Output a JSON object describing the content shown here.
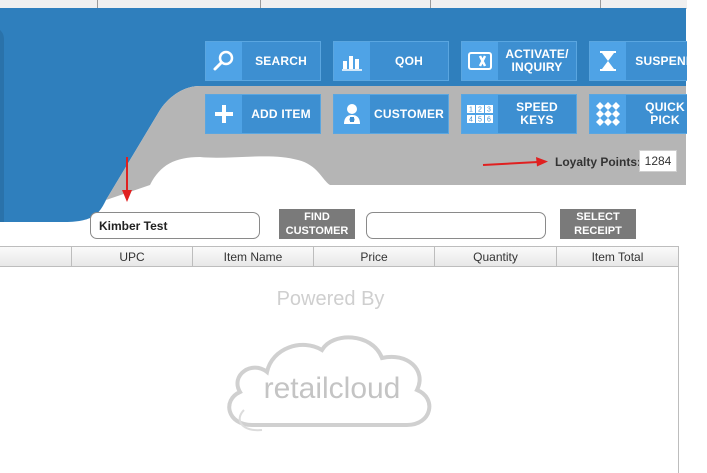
{
  "toolbar": {
    "row1": [
      {
        "label": "SEARCH",
        "icon": "magnifier-icon"
      },
      {
        "label": "QOH",
        "icon": "bar-chart-icon"
      },
      {
        "label": "ACTIVATE/\nINQUIRY",
        "icon": "card-icon"
      },
      {
        "label": "SUSPEND",
        "icon": "hourglass-icon"
      }
    ],
    "row2": [
      {
        "label": "ADD ITEM",
        "icon": "plus-icon"
      },
      {
        "label": "CUSTOMER",
        "icon": "customer-icon"
      },
      {
        "label": "SPEED KEYS",
        "icon": "keypad-icon"
      },
      {
        "label": "QUICK PICK",
        "icon": "grid-diamonds-icon"
      }
    ],
    "speed_keys_glyphs": [
      "1",
      "2",
      "3",
      "4",
      "5",
      "6"
    ]
  },
  "loyalty": {
    "label": "Loyalty Points:",
    "value": "1284"
  },
  "customer": {
    "name_value": "Kimber Test",
    "find_button": "FIND\nCUSTOMER",
    "receipt_value": "",
    "select_receipt_button": "SELECT\nRECEIPT"
  },
  "grid": {
    "columns": [
      "",
      "UPC",
      "Item Name",
      "Price",
      "Quantity",
      "Item Total"
    ],
    "rows": []
  },
  "watermark": {
    "powered_by": "Powered By",
    "brand": "retailcloud"
  },
  "colors": {
    "header_blue": "#2f7fbd",
    "button_blue": "#3d8fd1",
    "band_grey": "#b5b5b5",
    "annotation_red": "#e02020"
  }
}
